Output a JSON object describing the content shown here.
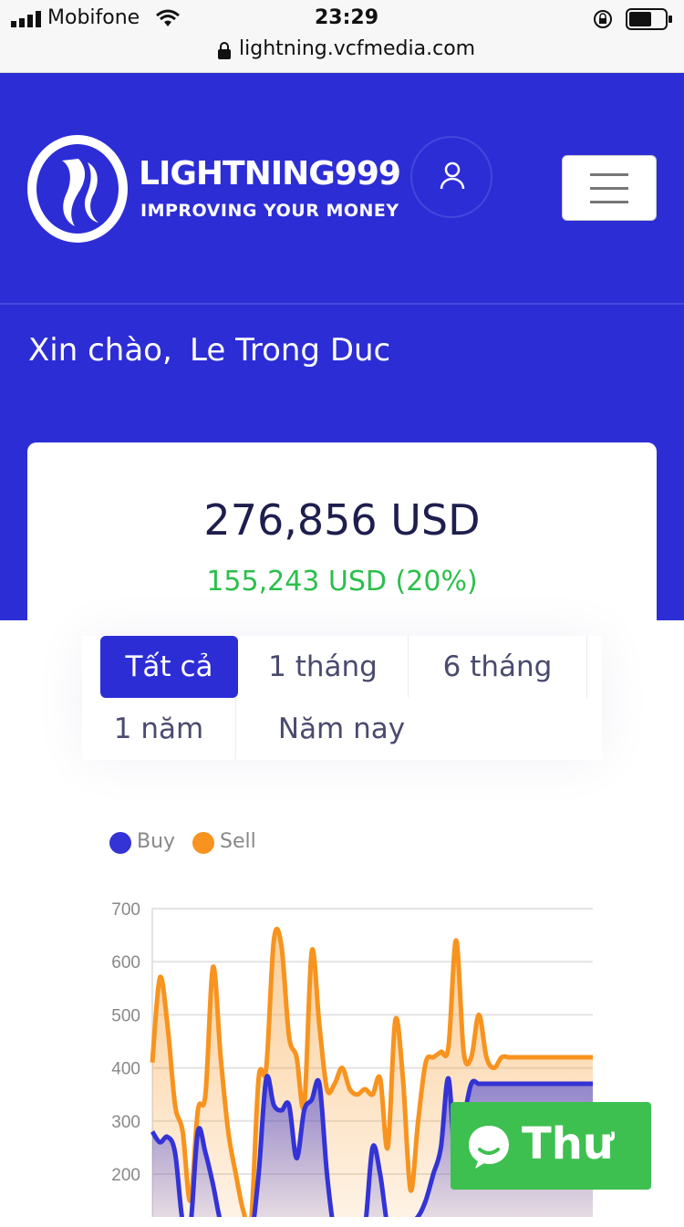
{
  "status": {
    "carrier": "Mobifone",
    "time": "23:29",
    "url": "lightning.vcfmedia.com"
  },
  "header": {
    "logo_title": "LIGHTNING999",
    "logo_subtitle": "IMPROVING YOUR MONEY"
  },
  "greeting": {
    "hello": "Xin chào,",
    "name": "Le Trong Duc"
  },
  "summary": {
    "balance": "276,856 USD",
    "profit": "155,243 USD (20%)",
    "profit_color": "#2cbf4b"
  },
  "filters": {
    "all": "Tất cả",
    "one_month": "1 tháng",
    "six_months": "6 tháng",
    "one_year": "1 năm",
    "this_year": "Năm nay",
    "active": "all"
  },
  "chat": {
    "label": "Thư"
  },
  "colors": {
    "brand": "#2d2dd6",
    "buy": "#3333d6",
    "sell": "#f7931e"
  },
  "chart_data": {
    "type": "area",
    "legend": [
      "Buy",
      "Sell"
    ],
    "y_ticks": [
      "700",
      "600",
      "500",
      "400",
      "300",
      "200"
    ],
    "ylim": [
      100,
      700
    ],
    "x": [
      0,
      1,
      2,
      3,
      4,
      5,
      6,
      7,
      8,
      9,
      10,
      11,
      12,
      13,
      14,
      15,
      16,
      17,
      18,
      19,
      20,
      21,
      22,
      23,
      24,
      25,
      26,
      27,
      28,
      29,
      30,
      31,
      32,
      33,
      34,
      35,
      36,
      37,
      38,
      39,
      40,
      41,
      42,
      43,
      44,
      45,
      46,
      47,
      48,
      49,
      50,
      51,
      52,
      53,
      54,
      55,
      56,
      57,
      58
    ],
    "series": [
      {
        "name": "Sell",
        "values": [
          410,
          570,
          480,
          330,
          280,
          150,
          320,
          350,
          590,
          420,
          280,
          200,
          130,
          110,
          380,
          400,
          640,
          630,
          460,
          420,
          330,
          620,
          480,
          360,
          370,
          400,
          360,
          350,
          360,
          350,
          380,
          250,
          490,
          380,
          170,
          300,
          410,
          420,
          430,
          440,
          640,
          430,
          420,
          500,
          420,
          400,
          420,
          420,
          420,
          420,
          420,
          420,
          420,
          420,
          420,
          420,
          420,
          420,
          420
        ]
      },
      {
        "name": "Buy",
        "values": [
          280,
          260,
          270,
          240,
          110,
          100,
          280,
          240,
          180,
          110,
          90,
          80,
          90,
          80,
          200,
          380,
          330,
          320,
          330,
          230,
          320,
          340,
          370,
          200,
          90,
          80,
          100,
          90,
          100,
          250,
          200,
          100,
          80,
          100,
          110,
          120,
          150,
          200,
          250,
          380,
          200,
          300,
          370,
          370,
          370,
          370,
          370,
          370,
          370,
          370,
          370,
          370,
          370,
          370,
          370,
          370,
          370,
          370,
          370
        ]
      }
    ]
  }
}
